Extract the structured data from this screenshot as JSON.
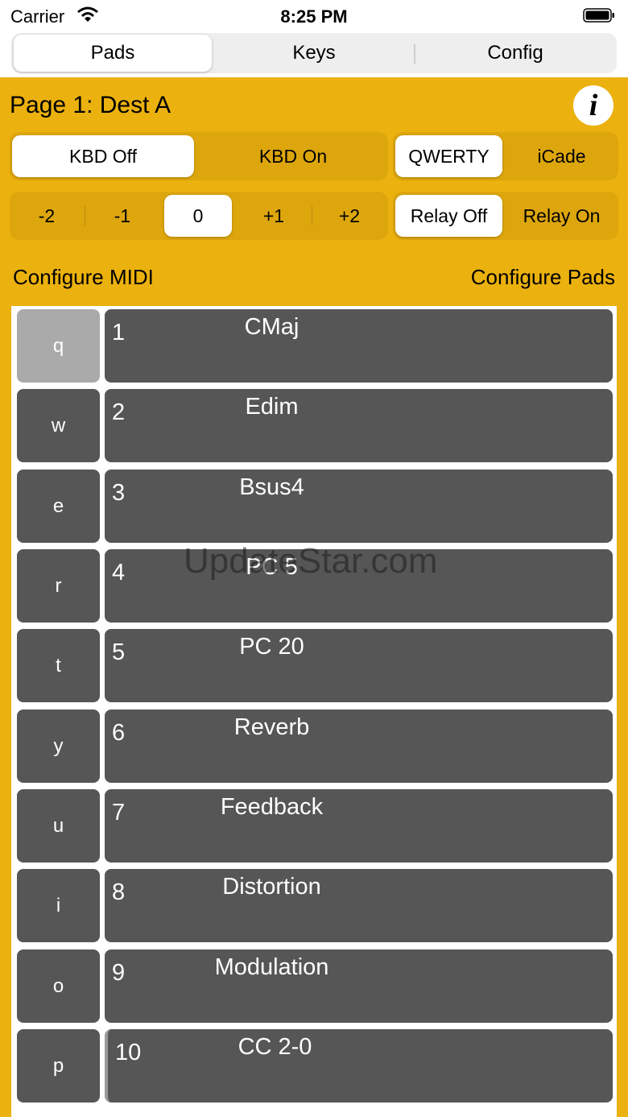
{
  "status": {
    "carrier": "Carrier",
    "time": "8:25 PM"
  },
  "tabs": [
    {
      "label": "Pads",
      "active": true
    },
    {
      "label": "Keys",
      "active": false
    },
    {
      "label": "Config",
      "active": false
    }
  ],
  "page_title": "Page 1: Dest A",
  "info_label": "i",
  "kbd_toggle": {
    "options": [
      "KBD Off",
      "KBD On"
    ],
    "selected": "KBD Off"
  },
  "input_mode": {
    "options": [
      "QWERTY",
      "iCade"
    ],
    "selected": "QWERTY"
  },
  "octave": {
    "options": [
      "-2",
      "-1",
      "0",
      "+1",
      "+2"
    ],
    "selected": "0"
  },
  "relay": {
    "options": [
      "Relay Off",
      "Relay On"
    ],
    "selected": "Relay Off"
  },
  "configure_midi": "Configure MIDI",
  "configure_pads": "Configure Pads",
  "pads": [
    {
      "key": "q",
      "num": "1",
      "name": "CMaj"
    },
    {
      "key": "w",
      "num": "2",
      "name": "Edim"
    },
    {
      "key": "e",
      "num": "3",
      "name": "Bsus4"
    },
    {
      "key": "r",
      "num": "4",
      "name": "PC 5"
    },
    {
      "key": "t",
      "num": "5",
      "name": "PC 20"
    },
    {
      "key": "y",
      "num": "6",
      "name": "Reverb"
    },
    {
      "key": "u",
      "num": "7",
      "name": "Feedback"
    },
    {
      "key": "i",
      "num": "8",
      "name": "Distortion"
    },
    {
      "key": "o",
      "num": "9",
      "name": "Modulation"
    },
    {
      "key": "p",
      "num": "10",
      "name": "CC 2-0"
    }
  ],
  "watermark": "UpdateStar.com",
  "colors": {
    "background": "#ebb10e",
    "pad": "#565656",
    "pad_active_key": "#aaaaaa"
  }
}
